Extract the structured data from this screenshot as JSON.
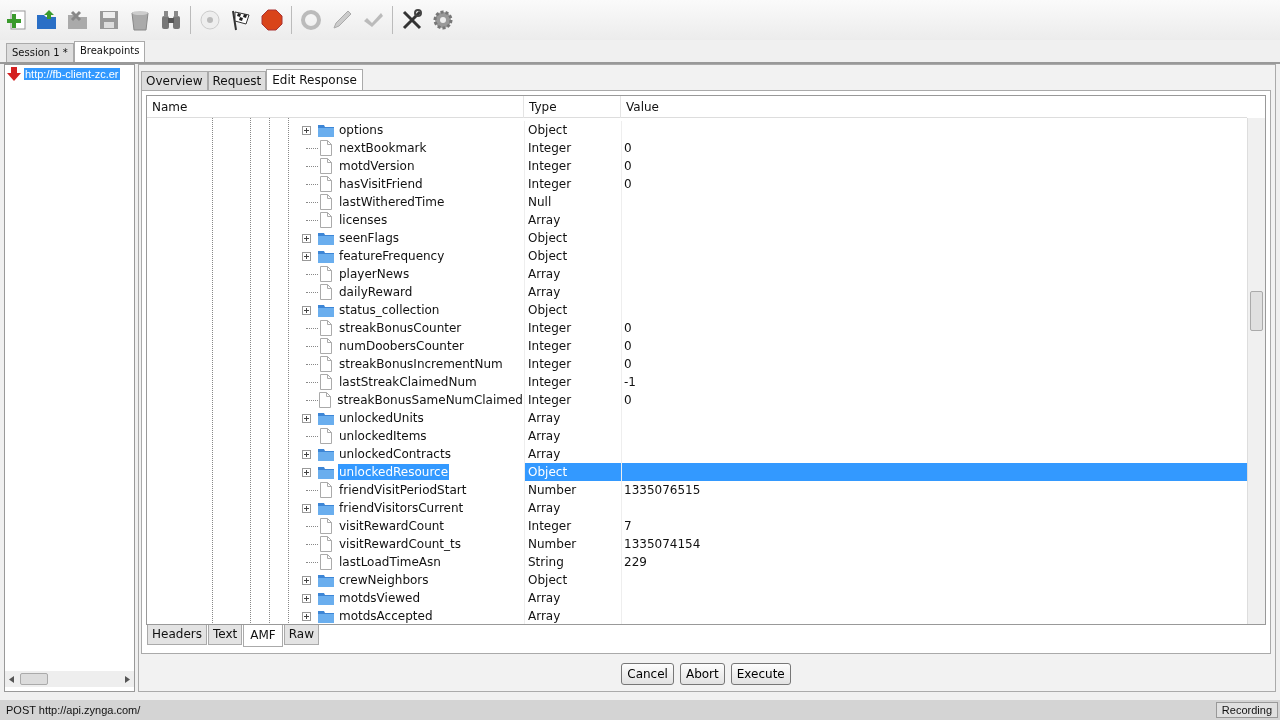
{
  "session_tabs": [
    {
      "label": "Session 1 *",
      "selected": false
    },
    {
      "label": "Breakpoints",
      "selected": true
    }
  ],
  "sessions": [
    {
      "url": "http://fb-client-zc.er",
      "selected": true
    }
  ],
  "detail_tabs": [
    {
      "label": "Overview",
      "selected": false
    },
    {
      "label": "Request",
      "selected": false
    },
    {
      "label": "Edit Response",
      "selected": true
    }
  ],
  "table": {
    "columns": [
      "Name",
      "Type",
      "Value"
    ],
    "rows": [
      {
        "kind": "object",
        "name": "options",
        "type": "Object",
        "selected": false
      },
      {
        "kind": "leaf",
        "name": "nextBookmark",
        "type": "Integer",
        "value": "0",
        "selected": false
      },
      {
        "kind": "leaf",
        "name": "motdVersion",
        "type": "Integer",
        "value": "0",
        "selected": false
      },
      {
        "kind": "leaf",
        "name": "hasVisitFriend",
        "type": "Integer",
        "value": "0",
        "selected": false
      },
      {
        "kind": "leaf",
        "name": "lastWitheredTime",
        "type": "Null",
        "selected": false
      },
      {
        "kind": "leaf",
        "name": "licenses",
        "type": "Array",
        "selected": false
      },
      {
        "kind": "object",
        "name": "seenFlags",
        "type": "Object",
        "selected": false
      },
      {
        "kind": "object",
        "name": "featureFrequency",
        "type": "Object",
        "selected": false
      },
      {
        "kind": "leaf",
        "name": "playerNews",
        "type": "Array",
        "selected": false
      },
      {
        "kind": "leaf",
        "name": "dailyReward",
        "type": "Array",
        "selected": false
      },
      {
        "kind": "object",
        "name": "status_collection",
        "type": "Object",
        "selected": false
      },
      {
        "kind": "leaf",
        "name": "streakBonusCounter",
        "type": "Integer",
        "value": "0",
        "selected": false
      },
      {
        "kind": "leaf",
        "name": "numDoobersCounter",
        "type": "Integer",
        "value": "0",
        "selected": false
      },
      {
        "kind": "leaf",
        "name": "streakBonusIncrementNum",
        "type": "Integer",
        "value": "0",
        "selected": false
      },
      {
        "kind": "leaf",
        "name": "lastStreakClaimedNum",
        "type": "Integer",
        "value": "-1",
        "selected": false
      },
      {
        "kind": "leaf",
        "name": "streakBonusSameNumClaimed",
        "type": "Integer",
        "value": "0",
        "selected": false
      },
      {
        "kind": "object",
        "name": "unlockedUnits",
        "type": "Array",
        "selected": false
      },
      {
        "kind": "leaf",
        "name": "unlockedItems",
        "type": "Array",
        "selected": false
      },
      {
        "kind": "object",
        "name": "unlockedContracts",
        "type": "Array",
        "selected": false
      },
      {
        "kind": "object",
        "name": "unlockedResource",
        "type": "Object",
        "selected": true
      },
      {
        "kind": "leaf",
        "name": "friendVisitPeriodStart",
        "type": "Number",
        "value": "1335076515",
        "selected": false
      },
      {
        "kind": "object",
        "name": "friendVisitorsCurrent",
        "type": "Array",
        "selected": false
      },
      {
        "kind": "leaf",
        "name": "visitRewardCount",
        "type": "Integer",
        "value": "7",
        "selected": false
      },
      {
        "kind": "leaf",
        "name": "visitRewardCount_ts",
        "type": "Number",
        "value": "1335074154",
        "selected": false
      },
      {
        "kind": "leaf",
        "name": "lastLoadTimeAsn",
        "type": "String",
        "value": "229",
        "selected": false
      },
      {
        "kind": "object",
        "name": "crewNeighbors",
        "type": "Object",
        "selected": false
      },
      {
        "kind": "object",
        "name": "motdsViewed",
        "type": "Array",
        "selected": false
      },
      {
        "kind": "object",
        "name": "motdsAccepted",
        "type": "Array",
        "selected": false
      }
    ]
  },
  "view_tabs": [
    {
      "label": "Headers",
      "selected": false
    },
    {
      "label": "Text",
      "selected": false
    },
    {
      "label": "AMF",
      "selected": true
    },
    {
      "label": "Raw",
      "selected": false
    }
  ],
  "buttons": [
    "Cancel",
    "Abort",
    "Execute"
  ],
  "status_bar": {
    "text": "POST http://api.zynga.com/",
    "recording": "Recording"
  }
}
